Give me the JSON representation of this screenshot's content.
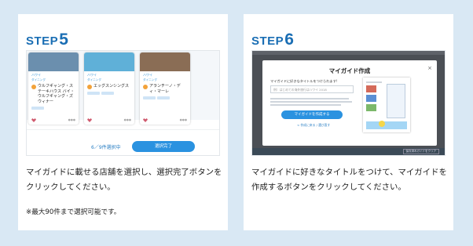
{
  "step5": {
    "label": "STEP",
    "number": "5",
    "description": "マイガイドに載せる店舗を選択し、選択完了ボタンをクリックしてください。",
    "note": "※最大90件まで選択可能です。",
    "screenshot": {
      "cards": [
        {
          "area": "ハワイ",
          "category": "ダイニング",
          "name": "ウルフギャング・ステーキハウス バイ・ウルフギャング・ズウィナー",
          "photo_color": "#6b8fae"
        },
        {
          "area": "ハワイ",
          "category": "ダイニング",
          "name": "エッグスンシングス",
          "photo_color": "#5fb0d8"
        },
        {
          "area": "ハワイ",
          "category": "ダイニング",
          "name": "アランチーノ・ディ・マーレ",
          "photo_color": "#8a6d55"
        }
      ],
      "counter": "6／9件選択中",
      "done_button": "選択完了"
    }
  },
  "step6": {
    "label": "STEP",
    "number": "6",
    "description": "マイガイドに好きなタイトルをつけて、マイガイドを作成するボタンをクリックしてください。",
    "screenshot": {
      "modal_title": "マイガイド作成",
      "close_symbol": "×",
      "title_label": "マイガイドに好きなタイトルをつけられます!",
      "title_placeholder": "例）はじめての海外旅行はハワイ 2018",
      "create_button": "マイガイドを作成する",
      "sub_link": "< 作成に戻る / 選び直す",
      "footer_button": "保存済みガイドをクリア"
    }
  }
}
